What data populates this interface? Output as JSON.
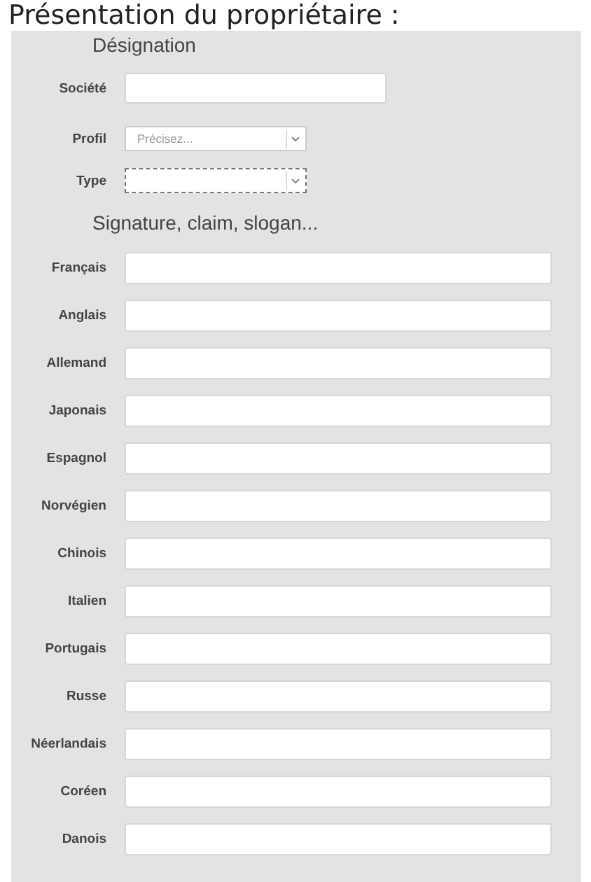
{
  "page_title": "Présentation du propriétaire :",
  "designation": {
    "heading": "Désignation",
    "fields": [
      {
        "kind": "text",
        "label": "Société"
      },
      {
        "kind": "select",
        "label": "Profil",
        "placeholder": "Précisez..."
      },
      {
        "kind": "select",
        "label": "Type",
        "focused": true
      }
    ]
  },
  "signature": {
    "heading": "Signature, claim, slogan...",
    "fields": [
      {
        "label": "Français"
      },
      {
        "label": "Anglais"
      },
      {
        "label": "Allemand"
      },
      {
        "label": "Japonais"
      },
      {
        "label": "Espagnol"
      },
      {
        "label": "Norvégien"
      },
      {
        "label": "Chinois"
      },
      {
        "label": "Italien"
      },
      {
        "label": "Portugais"
      },
      {
        "label": "Russe"
      },
      {
        "label": "Néerlandais"
      },
      {
        "label": "Coréen"
      },
      {
        "label": "Danois"
      }
    ]
  }
}
